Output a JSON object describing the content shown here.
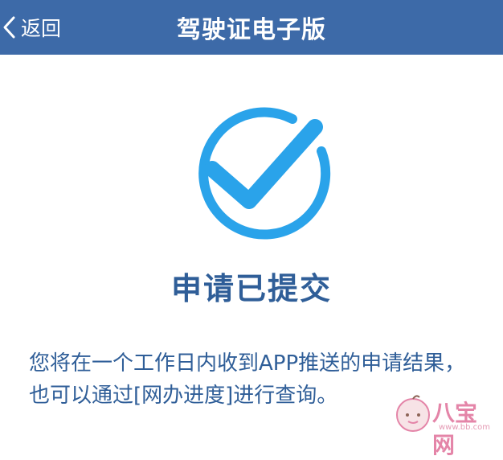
{
  "header": {
    "back_label": "返回",
    "title": "驾驶证电子版",
    "back_icon": "chevron-left-icon",
    "background": "#3d6aa8"
  },
  "status": {
    "icon": "checkmark-circle-icon",
    "icon_color": "#2aa3ea",
    "title": "申请已提交"
  },
  "message": {
    "text": "您将在一个工作日内收到APP推送的申请结果，也可以通过[网办进度]进行查询。"
  },
  "watermark": {
    "text": "八宝网",
    "url": "www.bb.com"
  }
}
